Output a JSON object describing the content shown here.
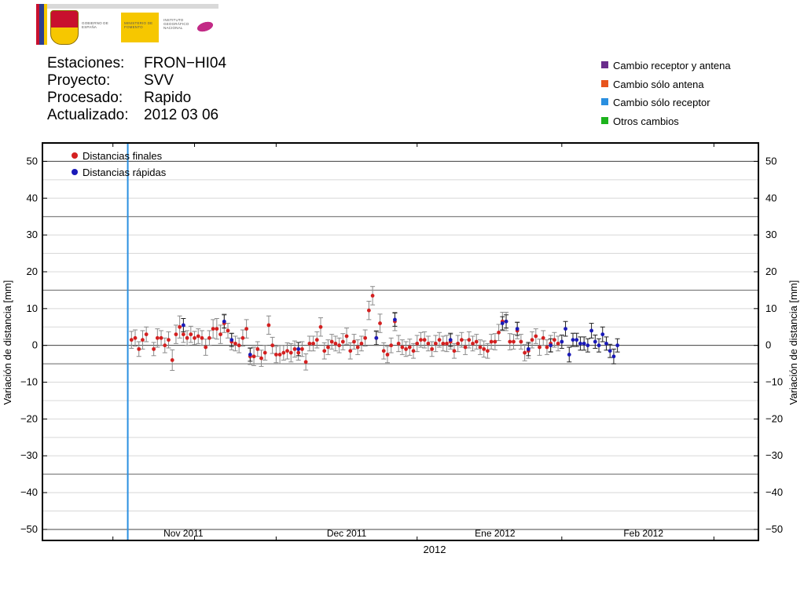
{
  "header": {
    "logo": {
      "gobierno": "GOBIERNO DE ESPAÑA",
      "ministerio": "MINISTERIO DE FOMENTO",
      "instituto": "INSTITUTO GEOGRÁFICO NACIONAL",
      "colors": {
        "red": "#c8102e",
        "yellow": "#f6c700",
        "magenta": "#c22a86"
      }
    },
    "info": [
      {
        "label": "Estaciones:",
        "value": "FRON−HI04"
      },
      {
        "label": "Proyecto:",
        "value": "SVV"
      },
      {
        "label": "Procesado:",
        "value": "Rapido"
      },
      {
        "label": "Actualizado:",
        "value": "2012 03 06"
      }
    ],
    "change_legend": [
      {
        "label": "Cambio receptor y antena",
        "color": "#6a2c8c"
      },
      {
        "label": "Cambio sólo antena",
        "color": "#e8541c"
      },
      {
        "label": "Cambio sólo receptor",
        "color": "#2a8fe0"
      },
      {
        "label": "Otros cambios",
        "color": "#1db31d"
      }
    ]
  },
  "chart_data": {
    "type": "scatter",
    "title": "",
    "xlabel": "2012",
    "ylabel": "Variación de distancia [mm]",
    "ylim": [
      -53,
      55
    ],
    "xlim": [
      0,
      193
    ],
    "yticks": [
      -50,
      -40,
      -30,
      -20,
      -10,
      0,
      10,
      20,
      30,
      40,
      50
    ],
    "month_ticks": [
      {
        "label": "Nov 2011",
        "x": 38
      },
      {
        "label": "Dec 2011",
        "x": 82
      },
      {
        "label": "Ene 2012",
        "x": 122
      },
      {
        "label": "Feb 2012",
        "x": 162
      }
    ],
    "minor_x_ticks": [
      0,
      19,
      41,
      63,
      101,
      140,
      181
    ],
    "grid": true,
    "reference_lines": [
      35,
      15,
      -5,
      -35
    ],
    "change_events": [
      {
        "x": 23,
        "type": "Cambio sólo receptor",
        "color": "#2a8fe0"
      }
    ],
    "legend": {
      "position": "top-left",
      "entries": [
        "Distancias finales",
        "Distancias rápidas"
      ]
    },
    "series": [
      {
        "name": "Distancias finales",
        "color": "#d42020",
        "points": [
          [
            24,
            1.5,
            2.3
          ],
          [
            25,
            2,
            2.2
          ],
          [
            26,
            -1,
            2
          ],
          [
            27,
            1.5,
            2.5
          ],
          [
            28,
            3,
            2
          ],
          [
            30,
            -1,
            1.8
          ],
          [
            31,
            2,
            2.5
          ],
          [
            32,
            2,
            2
          ],
          [
            33,
            0,
            2
          ],
          [
            34,
            1.5,
            2.2
          ],
          [
            35,
            -4,
            2.8
          ],
          [
            36,
            3,
            2.5
          ],
          [
            37,
            5,
            3
          ],
          [
            38,
            3,
            2.2
          ],
          [
            39,
            2,
            2
          ],
          [
            40,
            3,
            2.2
          ],
          [
            41,
            2,
            1.8
          ],
          [
            42,
            2.5,
            2
          ],
          [
            43,
            2,
            2
          ],
          [
            44,
            -0.5,
            2.2
          ],
          [
            45,
            2,
            2
          ],
          [
            46,
            4.5,
            2.5
          ],
          [
            47,
            4.5,
            2.8
          ],
          [
            48,
            3,
            2.5
          ],
          [
            49,
            6,
            2.5
          ],
          [
            50,
            4,
            2
          ],
          [
            51,
            1,
            2.2
          ],
          [
            52,
            0.5,
            2
          ],
          [
            53,
            0,
            2
          ],
          [
            54,
            2,
            2.2
          ],
          [
            55,
            4.5,
            2.5
          ],
          [
            56,
            -3,
            2.2
          ],
          [
            57,
            -3,
            2.5
          ],
          [
            58,
            -1,
            2
          ],
          [
            59,
            -3.5,
            2.2
          ],
          [
            60,
            -2,
            2
          ],
          [
            61,
            5.5,
            2.5
          ],
          [
            62,
            0,
            2.2
          ],
          [
            63,
            -2.5,
            2.2
          ],
          [
            64,
            -2.5,
            2.5
          ],
          [
            65,
            -2,
            2
          ],
          [
            66,
            -1.5,
            2.2
          ],
          [
            67,
            -2,
            2.5
          ],
          [
            68,
            -1,
            2.2
          ],
          [
            69,
            -2,
            2
          ],
          [
            70,
            -1,
            2
          ],
          [
            71,
            -4.5,
            2.2
          ],
          [
            72,
            0.5,
            2
          ],
          [
            73,
            0.5,
            2
          ],
          [
            74,
            1.5,
            2.2
          ],
          [
            75,
            5,
            2.5
          ],
          [
            76,
            -1.5,
            2.2
          ],
          [
            77,
            -0.5,
            2
          ],
          [
            78,
            1,
            2
          ],
          [
            79,
            0.5,
            2
          ],
          [
            80,
            0,
            2
          ],
          [
            81,
            1,
            2.2
          ],
          [
            82,
            2.5,
            2.2
          ],
          [
            83,
            -1.5,
            2.2
          ],
          [
            84,
            1,
            2
          ],
          [
            85,
            -0.5,
            2
          ],
          [
            86,
            0.5,
            2
          ],
          [
            87,
            2,
            2.2
          ],
          [
            88,
            9.5,
            2.5
          ],
          [
            89,
            13.5,
            2.5
          ],
          [
            90,
            2,
            2
          ],
          [
            91,
            6,
            2.5
          ],
          [
            92,
            -1.5,
            2.2
          ],
          [
            93,
            -2.5,
            2.2
          ],
          [
            94,
            0,
            2
          ],
          [
            95,
            6.5,
            2.5
          ],
          [
            96,
            0.5,
            2.2
          ],
          [
            97,
            -0.5,
            2
          ],
          [
            98,
            -1,
            2
          ],
          [
            99,
            -0.5,
            2.2
          ],
          [
            100,
            -1.5,
            2
          ],
          [
            101,
            0.5,
            2.2
          ],
          [
            102,
            1.5,
            2
          ],
          [
            103,
            1.5,
            2.2
          ],
          [
            104,
            0.5,
            2
          ],
          [
            105,
            -1,
            2
          ],
          [
            106,
            0.5,
            2.2
          ],
          [
            107,
            1.5,
            2
          ],
          [
            108,
            0.5,
            2
          ],
          [
            109,
            0.5,
            2.2
          ],
          [
            110,
            1,
            2
          ],
          [
            111,
            -1.5,
            2
          ],
          [
            112,
            0.5,
            2.2
          ],
          [
            113,
            1.5,
            2
          ],
          [
            114,
            -0.5,
            2
          ],
          [
            115,
            1.5,
            2.2
          ],
          [
            116,
            0.5,
            2
          ],
          [
            117,
            1,
            2
          ],
          [
            118,
            -0.5,
            2
          ],
          [
            119,
            -1,
            2.2
          ],
          [
            120,
            -1.5,
            2
          ],
          [
            121,
            1,
            2
          ],
          [
            122,
            1,
            2.2
          ],
          [
            123,
            3.5,
            2.2
          ],
          [
            124,
            6.5,
            2.5
          ],
          [
            125,
            6.5,
            2.5
          ],
          [
            126,
            1,
            2.2
          ],
          [
            127,
            1,
            2
          ],
          [
            128,
            4,
            2.2
          ],
          [
            129,
            1,
            2
          ],
          [
            130,
            -2,
            2.2
          ],
          [
            131,
            -1.5,
            2
          ],
          [
            132,
            1.5,
            2.2
          ],
          [
            133,
            2.5,
            2
          ],
          [
            134,
            -0.5,
            2.2
          ],
          [
            135,
            2,
            2
          ],
          [
            136,
            -0.5,
            2
          ],
          [
            137,
            0.5,
            2.2
          ],
          [
            138,
            1.5,
            2
          ],
          [
            139,
            0.5,
            2
          ]
        ]
      },
      {
        "name": "Distancias rápidas",
        "color": "#1a1ab8",
        "points": [
          [
            38,
            5.5,
            1.8
          ],
          [
            49,
            6.5,
            1.8
          ],
          [
            51,
            1.5,
            1.8
          ],
          [
            56,
            -2.5,
            1.8
          ],
          [
            69,
            -1,
            1.8
          ],
          [
            90,
            2,
            1.8
          ],
          [
            95,
            7,
            1.8
          ],
          [
            110,
            1.5,
            1.8
          ],
          [
            124,
            6,
            1.8
          ],
          [
            125,
            6.5,
            1.8
          ],
          [
            128,
            4.5,
            1.8
          ],
          [
            131,
            -1,
            1.8
          ],
          [
            137,
            0,
            1.8
          ],
          [
            140,
            1,
            1.8
          ],
          [
            141,
            4.5,
            2
          ],
          [
            142,
            -2.5,
            2
          ],
          [
            143,
            1.5,
            1.8
          ],
          [
            144,
            1.5,
            1.8
          ],
          [
            145,
            0.5,
            1.8
          ],
          [
            146,
            0.5,
            1.8
          ],
          [
            147,
            0,
            1.8
          ],
          [
            148,
            4,
            2
          ],
          [
            149,
            1,
            1.8
          ],
          [
            150,
            0,
            1.8
          ],
          [
            151,
            3,
            2
          ],
          [
            152,
            0.5,
            1.8
          ],
          [
            153,
            -1.5,
            1.8
          ],
          [
            154,
            -3,
            2
          ],
          [
            155,
            0,
            1.8
          ]
        ]
      }
    ]
  }
}
